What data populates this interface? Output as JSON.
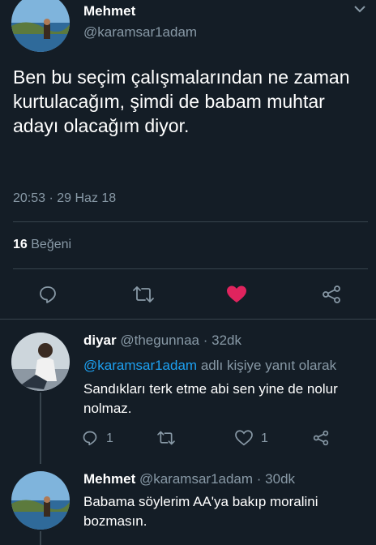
{
  "main_tweet": {
    "display_name": "Mehmet",
    "handle": "@karamsar1adam",
    "text": "Ben bu seçim çalışmalarından ne zaman kurtulacağım, şimdi de babam muhtar adayı olacağım diyor.",
    "timestamp": "20:53 · 29 Haz 18",
    "likes_count": "16",
    "likes_label": "Beğeni"
  },
  "reply1": {
    "display_name": "diyar",
    "handle": "@thegunnaa",
    "time": "· 32dk",
    "reply_to": "@karamsar1adam",
    "reply_to_suffix": "adlı kişiye yanıt olarak",
    "text": "Sandıkları terk etme abi sen yine de nolur nolmaz.",
    "reply_count": "1",
    "like_count": "1"
  },
  "reply2": {
    "display_name": "Mehmet",
    "handle": "@karamsar1adam",
    "time": "· 30dk",
    "text": "Babama söylerim AA'ya bakıp moralini bozmasın."
  },
  "colors": {
    "background": "#141d26",
    "muted": "#8899a6",
    "link": "#1da1f2",
    "like": "#e0245e",
    "divider": "#38444d"
  }
}
